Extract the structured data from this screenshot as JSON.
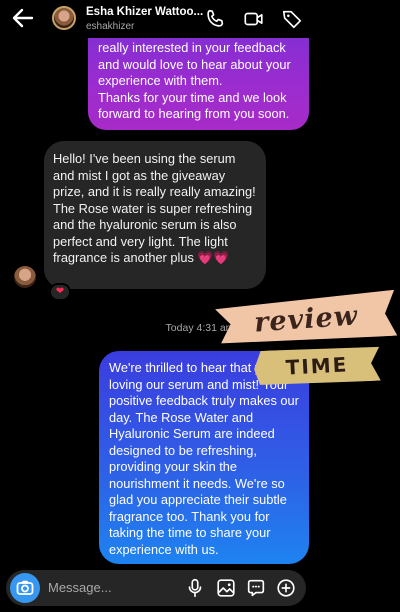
{
  "header": {
    "name": "Esha Khizer Wattoo...",
    "handle": "eshakhizer"
  },
  "messages": {
    "outgoing_1": "really interested in your feedback and would love to hear about your experience with them.\nThanks for your time and we look forward to hearing from you soon.",
    "incoming_1": "Hello! I've been using the serum and mist I got as the giveaway prize, and it is really really amazing! The Rose water is super refreshing and the hyaluronic serum is also perfect and very light. The light fragrance is another plus 💗💗",
    "reaction": "❤",
    "timestamp": "Today 4:31 am",
    "outgoing_2": "We're thrilled to hear that you're loving our serum and mist! Your positive feedback truly makes our day. The Rose Water and Hyaluronic Serum are indeed designed to be refreshing, providing your skin the nourishment it needs. We're so glad you appreciate their subtle fragrance too. Thank you for taking the time to share your experience with us."
  },
  "stickers": {
    "review": "review",
    "time": "TIME"
  },
  "composer": {
    "placeholder": "Message..."
  },
  "colors": {
    "accent_blue": "#3797f0",
    "incoming_bg": "#262626",
    "outgoing_purple": "#9b2ccf",
    "outgoing_blue": "#2f5fe6"
  }
}
